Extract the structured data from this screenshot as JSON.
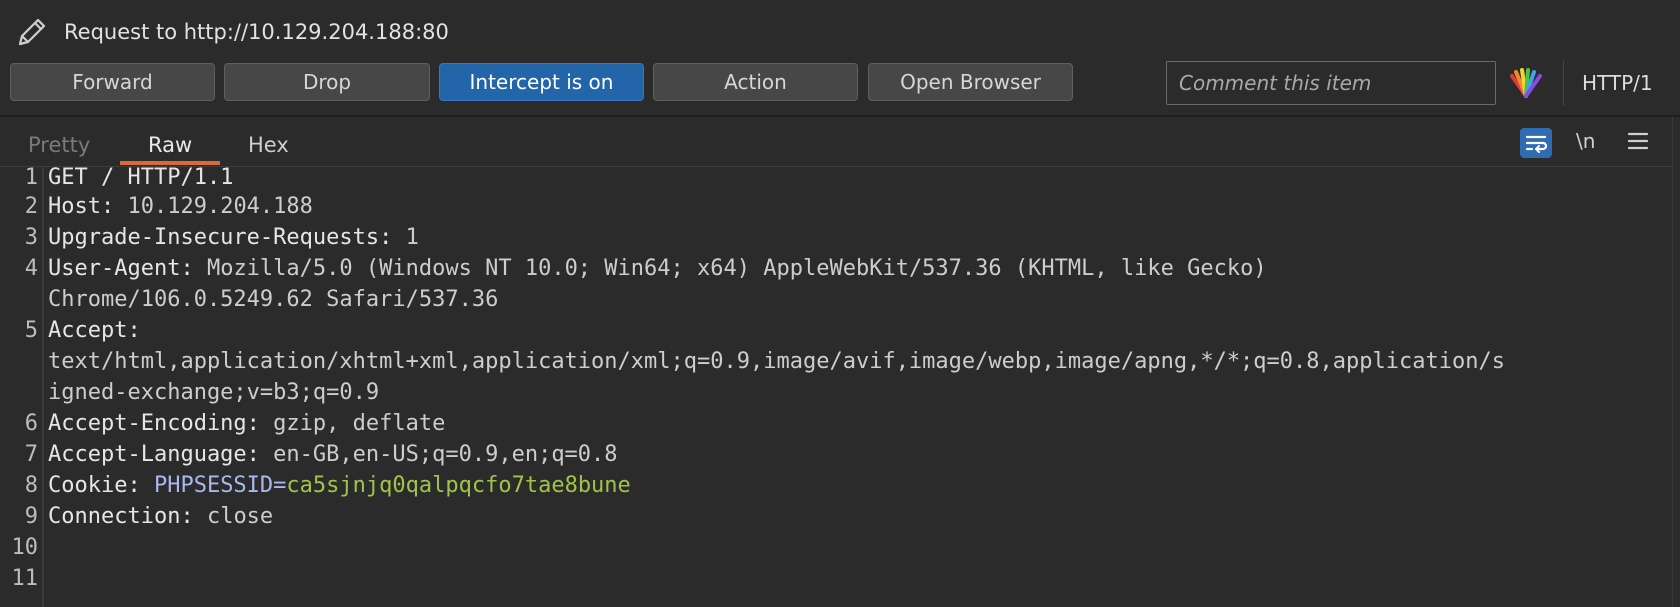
{
  "header": {
    "title": "Request to http://10.129.204.188:80",
    "pencil_icon": "pencil-icon"
  },
  "toolbar": {
    "forward_label": "Forward",
    "drop_label": "Drop",
    "intercept_label": "Intercept is on",
    "action_label": "Action",
    "open_browser_label": "Open Browser",
    "comment_placeholder": "Comment this item",
    "highlight_icon": "highlight-icon",
    "http_version": "HTTP/1"
  },
  "tabs": [
    {
      "label": "Pretty"
    },
    {
      "label": "Raw"
    },
    {
      "label": "Hex"
    }
  ],
  "active_tab": "Raw",
  "editor_tools": {
    "wrap_icon": "word-wrap-icon",
    "newline_label": "\\n",
    "menu_icon": "menu-icon"
  },
  "colors": {
    "primary_button": "#2265a9",
    "tab_underline": "#d86a3a",
    "cookie_name": "#a9b9f0",
    "cookie_value": "#9fc447"
  },
  "request": {
    "line_numbers": [
      "1",
      "2",
      "3",
      "4",
      "5",
      "6",
      "7",
      "8",
      "9",
      "10",
      "11"
    ],
    "line1": "GET / HTTP/1.1",
    "host_name": "Host:",
    "host_value": " 10.129.204.188",
    "uir_name": "Upgrade-Insecure-Requests:",
    "uir_value": " 1",
    "ua_name": "User-Agent:",
    "ua_value_1": " Mozilla/5.0 (Windows NT 10.0; Win64; x64) AppleWebKit/537.36 (KHTML, like Gecko)",
    "ua_value_2": "Chrome/106.0.5249.62 Safari/537.36",
    "accept_name": "Accept:",
    "accept_value_1": "text/html,application/xhtml+xml,application/xml;q=0.9,image/avif,image/webp,image/apng,*/*;q=0.8,application/s",
    "accept_value_2": "igned-exchange;v=b3;q=0.9",
    "ae_name": "Accept-Encoding:",
    "ae_value": " gzip, deflate",
    "al_name": "Accept-Language:",
    "al_value": " en-GB,en-US;q=0.9,en;q=0.8",
    "cookie_name": "Cookie:",
    "cookie_key": " PHPSESSID=",
    "cookie_val": "ca5sjnjq0qalpqcfo7tae8bune",
    "conn_name": "Connection:",
    "conn_value": " close"
  }
}
